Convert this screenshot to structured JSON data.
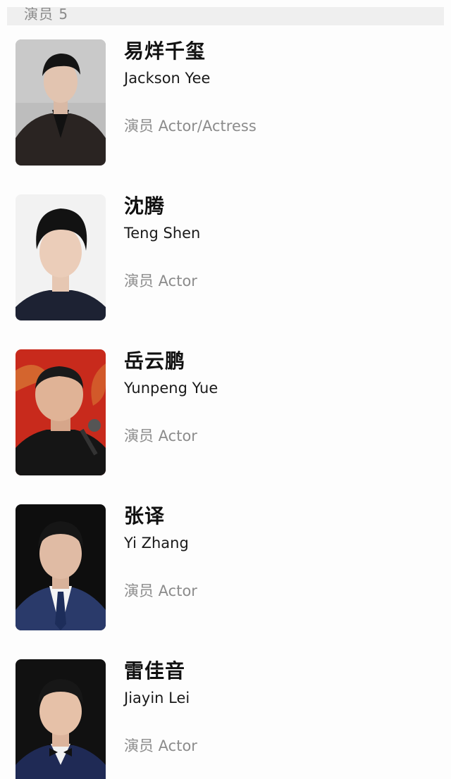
{
  "section": {
    "title": "演员 5"
  },
  "cast": [
    {
      "name_cn": "易烊千玺",
      "name_en": "Jackson Yee",
      "role": "演员 Actor/Actress"
    },
    {
      "name_cn": "沈腾",
      "name_en": "Teng Shen",
      "role": "演员 Actor"
    },
    {
      "name_cn": "岳云鹏",
      "name_en": "Yunpeng Yue",
      "role": "演员 Actor"
    },
    {
      "name_cn": "张译",
      "name_en": "Yi Zhang",
      "role": "演员 Actor"
    },
    {
      "name_cn": "雷佳音",
      "name_en": "Jiayin Lei",
      "role": "演员 Actor"
    }
  ]
}
